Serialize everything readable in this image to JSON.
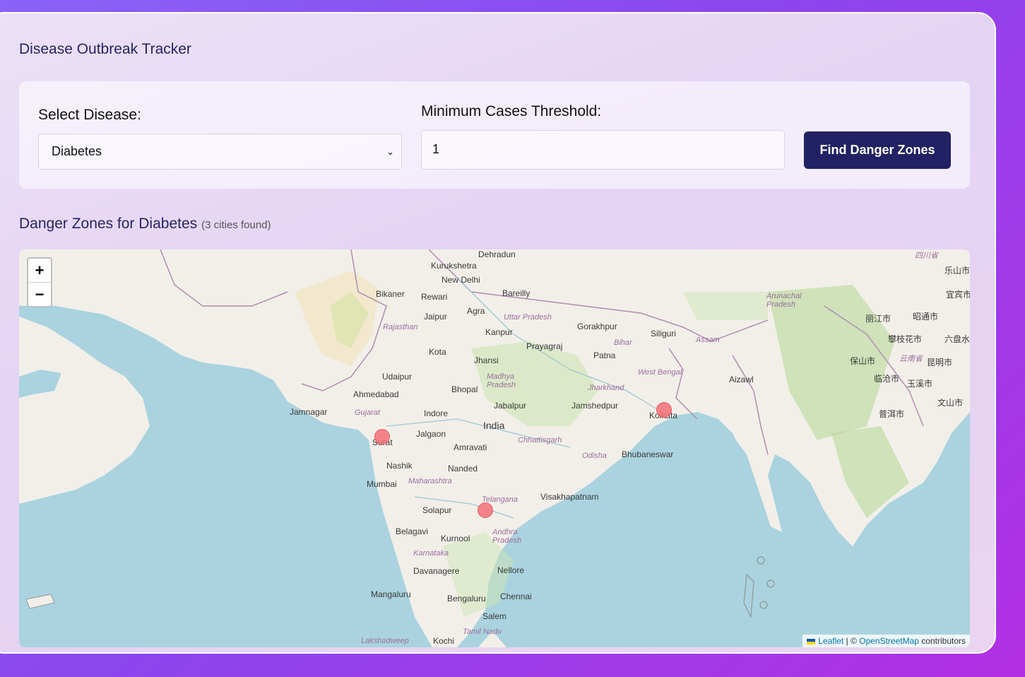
{
  "app": {
    "title": "Disease Outbreak Tracker"
  },
  "controls": {
    "disease_label": "Select Disease:",
    "disease_value": "Diabetes",
    "threshold_label": "Minimum Cases Threshold:",
    "threshold_value": "1",
    "find_button": "Find Danger Zones"
  },
  "results": {
    "heading": "Danger Zones for Diabetes",
    "count_text": "(3 cities found)"
  },
  "map": {
    "zoom_in": "+",
    "zoom_out": "−",
    "attribution": {
      "leaflet": "Leaflet",
      "separator": " | © ",
      "osm": "OpenStreetMap",
      "contributors": " contributors"
    },
    "markers": [
      {
        "city": "Surat",
        "color": "#f37078"
      },
      {
        "city": "Kolkata",
        "color": "#f37078"
      },
      {
        "city": "Hyderabad",
        "color": "#f37078"
      }
    ],
    "labels": {
      "dehradun": "Dehradun",
      "kurukshetra": "Kurukshetra",
      "new_delhi": "New Delhi",
      "bikaner": "Bikaner",
      "rewari": "Rewari",
      "agra": "Agra",
      "bareilly": "Bareilly",
      "jaipur": "Jaipur",
      "kanpur": "Kanpur",
      "gorakhpur": "Gorakhpur",
      "siliguri": "Siliguri",
      "prayagraj": "Prayagraj",
      "patna": "Patna",
      "kota": "Kota",
      "jhansi": "Jhansi",
      "udaipur": "Udaipur",
      "ahmedabad": "Ahmedabad",
      "bhopal": "Bhopal",
      "jabalpur": "Jabalpur",
      "jamshedpur": "Jamshedpur",
      "jamnagar": "Jamnagar",
      "indore": "Indore",
      "india": "India",
      "kolkata": "Kolkata",
      "surat": "Surat",
      "jalgaon": "Jalgaon",
      "amravati": "Amravati",
      "bhubaneswar": "Bhubaneswar",
      "nashik": "Nashik",
      "nanded": "Nanded",
      "mumbai": "Mumbai",
      "visakhapatnam": "Visakhapatnam",
      "solapur": "Solapur",
      "belagavi": "Belagavi",
      "kurnool": "Kurnool",
      "davanagere": "Davanagere",
      "nellore": "Nellore",
      "mangaluru": "Mangaluru",
      "bengaluru": "Bengaluru",
      "chennai": "Chennai",
      "salem": "Salem",
      "kochi": "Kochi",
      "aizawl": "Aizawl",
      "uttar_pradesh": "Uttar Pradesh",
      "rajasthan": "Rajasthan",
      "bihar": "Bihar",
      "west_bengal": "West Bengal",
      "madhya_pradesh": "Madhya Pradesh",
      "jharkhand": "Jharkhand",
      "gujarat": "Gujarat",
      "chhattisgarh": "Chhattisgarh",
      "odisha": "Odisha",
      "maharashtra": "Maharashtra",
      "telangana": "Telangana",
      "andhra_pradesh": "Andhra Pradesh",
      "karnataka": "Karnataka",
      "tamil_nadu": "Tamil Nadu",
      "lakshadweep": "Lakshadweep",
      "assam": "Assam",
      "arunachal": "Arunachal Pradesh",
      "lijiang": "丽江市",
      "panzhihua": "攀枝花市",
      "baoshan": "保山市",
      "kunming": "昆明市",
      "lincang": "临沧市",
      "yuxi": "玉溪市",
      "puer": "普洱市",
      "wenshan": "文山市",
      "leshan": "乐山市",
      "yibin": "宜宾市",
      "zhaotong": "昭通市",
      "liupanshui": "六盘水",
      "yunnan": "云南省",
      "sichuan": "四川省"
    }
  }
}
